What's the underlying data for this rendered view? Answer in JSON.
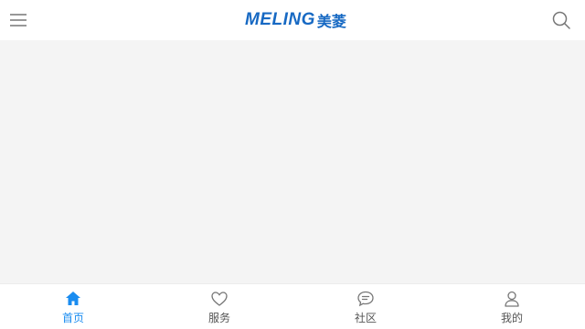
{
  "header": {
    "logo_latin": "MELING",
    "logo_cjk": "美菱"
  },
  "colors": {
    "brand_blue": "#1769c3",
    "active_tab": "#1a8cf0",
    "inactive_tab": "#555555",
    "icon_gray": "#777777"
  },
  "tabs": [
    {
      "label": "首页",
      "icon": "home-icon",
      "active": true
    },
    {
      "label": "服务",
      "icon": "heart-icon",
      "active": false
    },
    {
      "label": "社区",
      "icon": "chat-bubble-icon",
      "active": false
    },
    {
      "label": "我的",
      "icon": "user-icon",
      "active": false
    }
  ]
}
